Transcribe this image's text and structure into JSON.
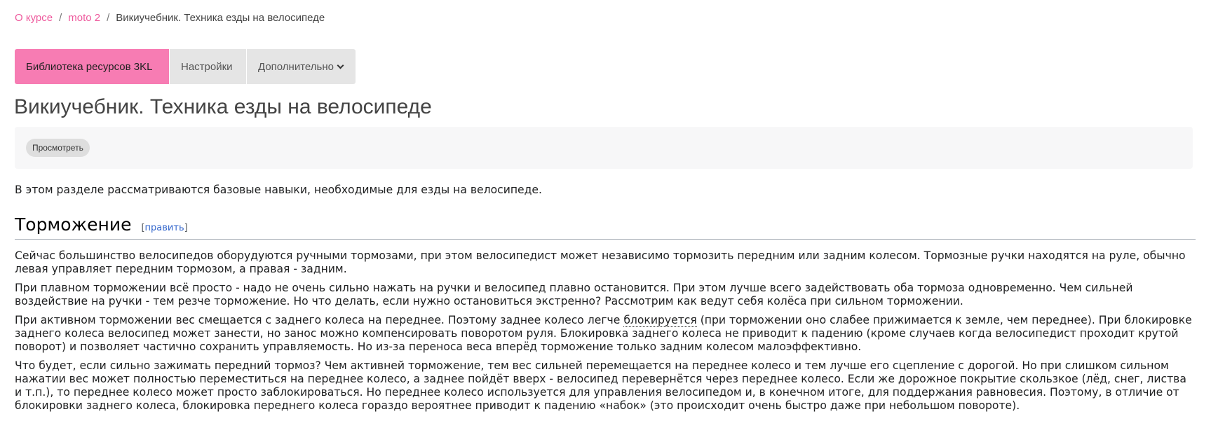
{
  "breadcrumb": {
    "items": [
      "О курсе",
      "moto 2"
    ],
    "current": "Викиучебник. Техника езды на велосипеде",
    "separator": "/"
  },
  "tabs": {
    "library": "Библиотека ресурсов 3KL",
    "settings": "Настройки",
    "more": "Дополнительно"
  },
  "page": {
    "title": "Викиучебник. Техника езды на велосипеде",
    "view_button": "Просмотреть"
  },
  "article": {
    "intro": "В этом разделе рассматриваются базовые навыки, необходимые для езды на велосипеде.",
    "section_title": "Торможение",
    "edit_open": "[",
    "edit_link": "править",
    "edit_close": "]",
    "p1": "Сейчас большинство велосипедов оборудуются ручными тормозами, при этом велосипедист может независимо тормозить передним или задним колесом. Тормозные ручки находятся на руле, обычно левая управляет передним тормозом, а правая - задним.",
    "p2": "При плавном торможении всё просто - надо не очень сильно нажать на ручки и велосипед плавно остановится. При этом лучше всего задействовать оба тормоза одновременно. Чем сильней воздействие на ручки - тем резче торможение. Но что делать, если нужно остановиться экстренно? Рассмотрим как ведут себя колёса при сильном торможении.",
    "p3_before": "При активном торможении вес смещается с заднего колеса на переднее. Поэтому заднее колесо легче ",
    "p3_term": "блокируется",
    "p3_after": " (при торможении оно слабее прижимается к земле, чем переднее). При блокировке заднего колеса велосипед может занести, но занос можно компенсировать поворотом руля. Блокировка заднего колеса не приводит к падению (кроме случаев когда велосипедист проходит крутой поворот) и позволяет частично сохранить управляемость. Но из-за переноса веса вперёд торможение только задним колесом малоэффективно.",
    "p4": "Что будет, если сильно зажимать передний тормоз? Чем активней торможение, тем вес сильней перемещается на переднее колесо и тем лучше его сцепление с дорогой. Но при слишком сильном нажатии вес может полностью переместиться на переднее колесо, а заднее пойдёт вверх - велосипед перевернётся через переднее колесо. Если же дорожное покрытие скользкое (лёд, снег, листва и т.п.), то переднее колесо может просто заблокироваться. Но переднее колесо используется для управления велосипедом и, в конечном итоге, для поддержания равновесия. Поэтому, в отличие от блокировки заднего колеса, блокировка переднего колеса гораздо вероятнее приводит к падению «набок» (это происходит очень быстро даже при небольшом повороте)."
  },
  "colors": {
    "accent": "#f77cb3",
    "link": "#ee5a9d",
    "wiki_link": "#3366cc"
  }
}
